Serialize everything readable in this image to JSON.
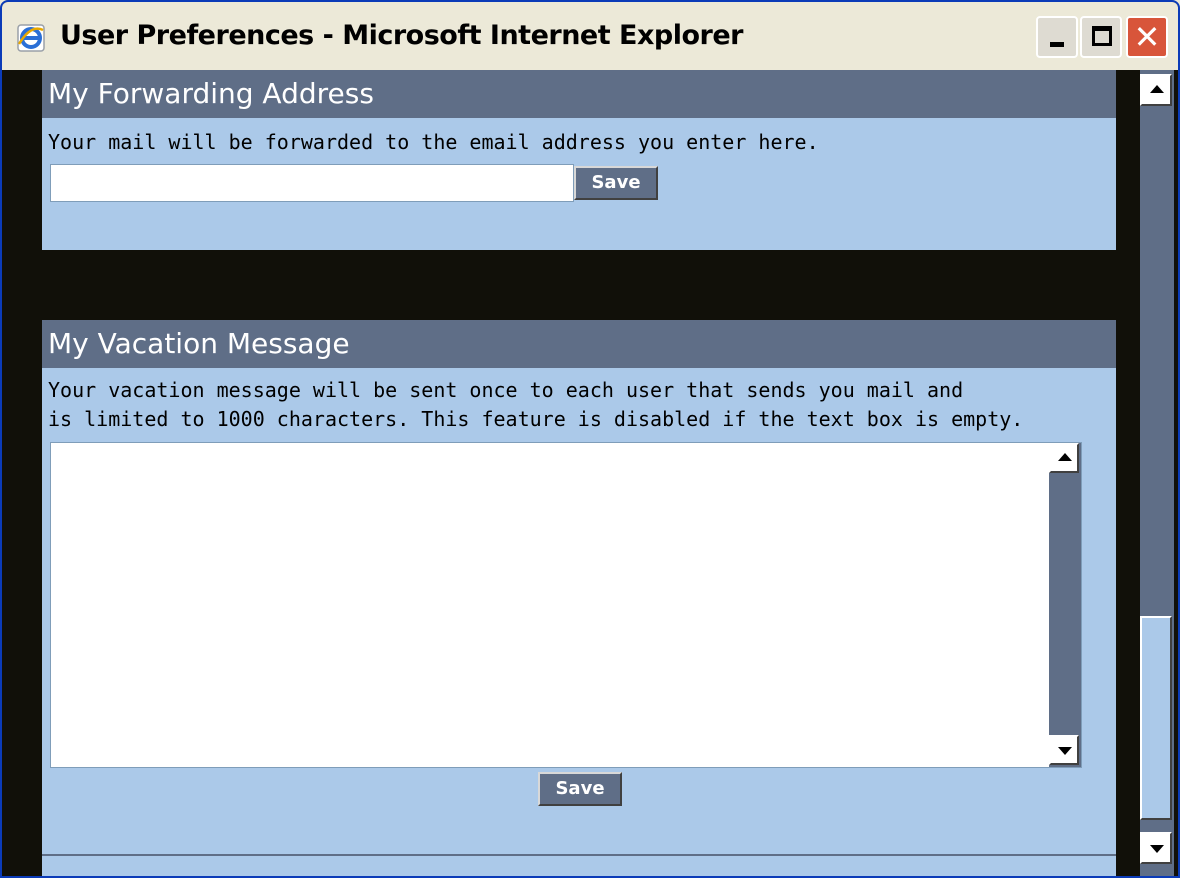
{
  "window": {
    "title": "User Preferences - Microsoft Internet Explorer",
    "icon": "ie-icon",
    "controls": [
      "minimize",
      "maximize",
      "close"
    ]
  },
  "forwarding": {
    "heading": "My Forwarding Address",
    "description": "Your mail will be forwarded to the email address you enter here.",
    "input_value": "",
    "save_label": "Save"
  },
  "vacation": {
    "heading": "My Vacation Message",
    "description_line1": "Your vacation message will be sent once to each user that sends you mail and",
    "description_line2": "is limited to 1000 characters. This feature is disabled if the text box is empty.",
    "message_value": "",
    "save_label": "Save"
  },
  "colors": {
    "panel_bg": "#abc9e9",
    "header_bg": "#5f6e87",
    "page_bg": "#111009"
  }
}
